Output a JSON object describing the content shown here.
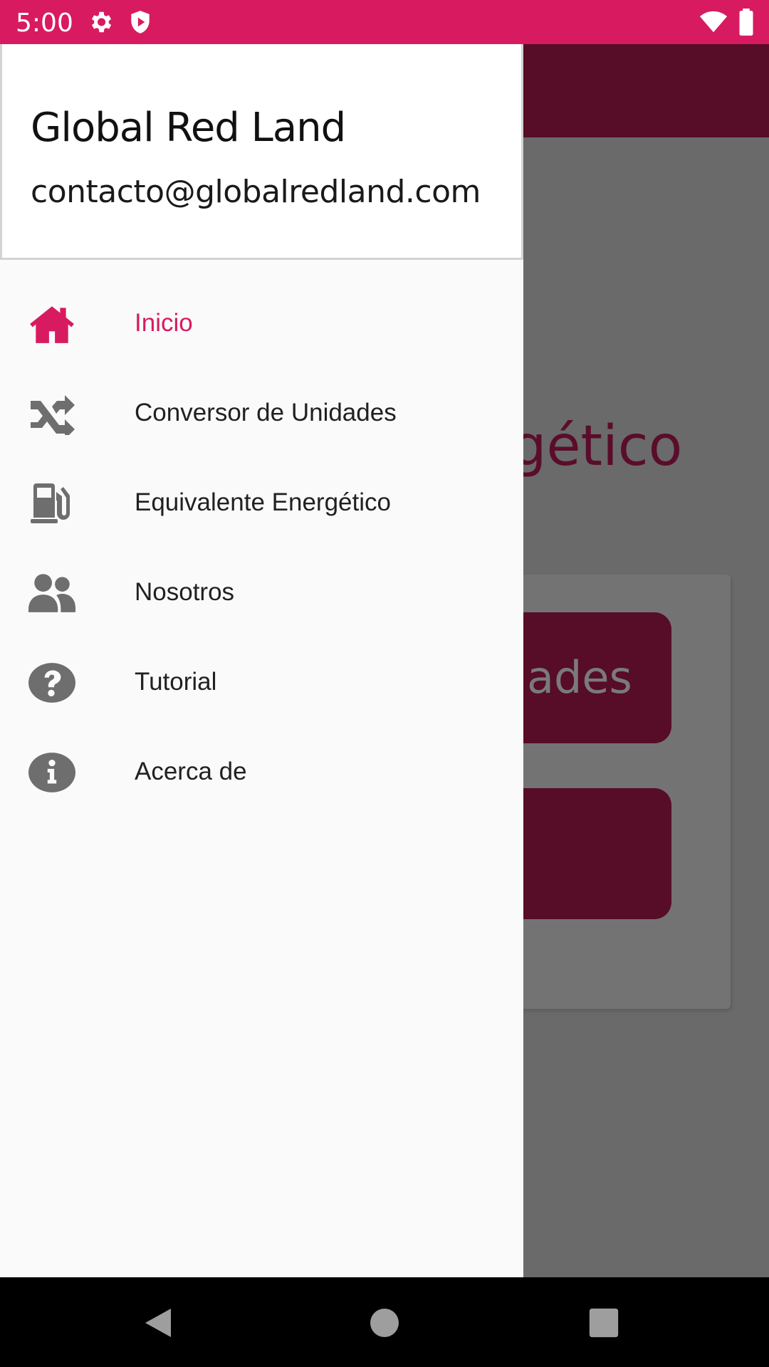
{
  "status_bar": {
    "time": "5:00",
    "icons": [
      "gear-icon",
      "shield-play-icon",
      "wifi-icon",
      "battery-icon"
    ],
    "color": "#d81b60"
  },
  "background_app": {
    "title_fragment": "gético",
    "button1_fragment": "ades",
    "toolbar_color": "#570c28"
  },
  "drawer": {
    "header": {
      "title": "Global Red Land",
      "email": "contacto@globalredland.com"
    },
    "items": [
      {
        "label": "Inicio",
        "icon": "home-icon",
        "active": true
      },
      {
        "label": "Conversor de Unidades",
        "icon": "shuffle-icon",
        "active": false
      },
      {
        "label": "Equivalente Energético",
        "icon": "gas-pump-icon",
        "active": false
      },
      {
        "label": "Nosotros",
        "icon": "users-icon",
        "active": false
      },
      {
        "label": "Tutorial",
        "icon": "question-circle-icon",
        "active": false
      },
      {
        "label": "Acerca de",
        "icon": "info-circle-icon",
        "active": false
      }
    ],
    "accent_color": "#d81b60",
    "icon_color": "#6e6e6e"
  },
  "nav_bar": {
    "icons": [
      "back-icon",
      "home-circle-icon",
      "recents-icon"
    ]
  }
}
